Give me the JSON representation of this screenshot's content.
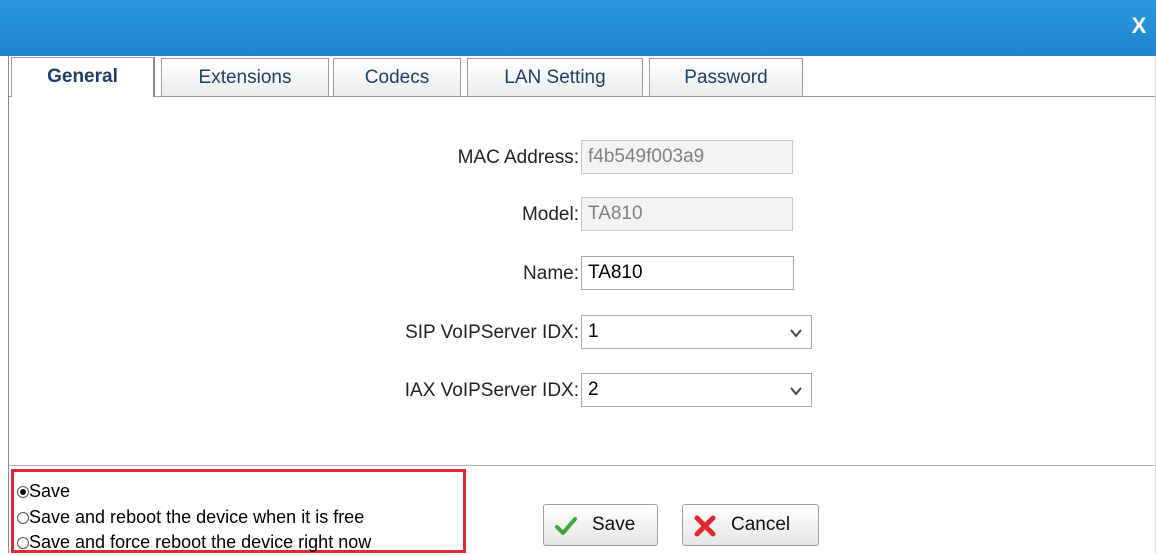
{
  "dialog": {
    "close_label": "X"
  },
  "tabs": [
    {
      "label": "General"
    },
    {
      "label": "Extensions"
    },
    {
      "label": "Codecs"
    },
    {
      "label": "LAN Setting"
    },
    {
      "label": "Password"
    }
  ],
  "form": {
    "mac_label": "MAC Address:",
    "mac_value": "f4b549f003a9",
    "model_label": "Model:",
    "model_value": "TA810",
    "name_label": "Name:",
    "name_value": "TA810",
    "sip_label": "SIP VoIPServer IDX:",
    "sip_value": "1",
    "iax_label": "IAX VoIPServer IDX:",
    "iax_value": "2"
  },
  "save_options": {
    "selected": "Save",
    "items": [
      {
        "label": "Save"
      },
      {
        "label": "Save and reboot the device when it is free"
      },
      {
        "label": "Save and force reboot the device right now"
      }
    ]
  },
  "buttons": {
    "save_label": "Save",
    "cancel_label": "Cancel"
  },
  "colors": {
    "titlebar": "#2290dc",
    "highlight_box": "#e0282e",
    "tab_text": "#1f3f66"
  }
}
